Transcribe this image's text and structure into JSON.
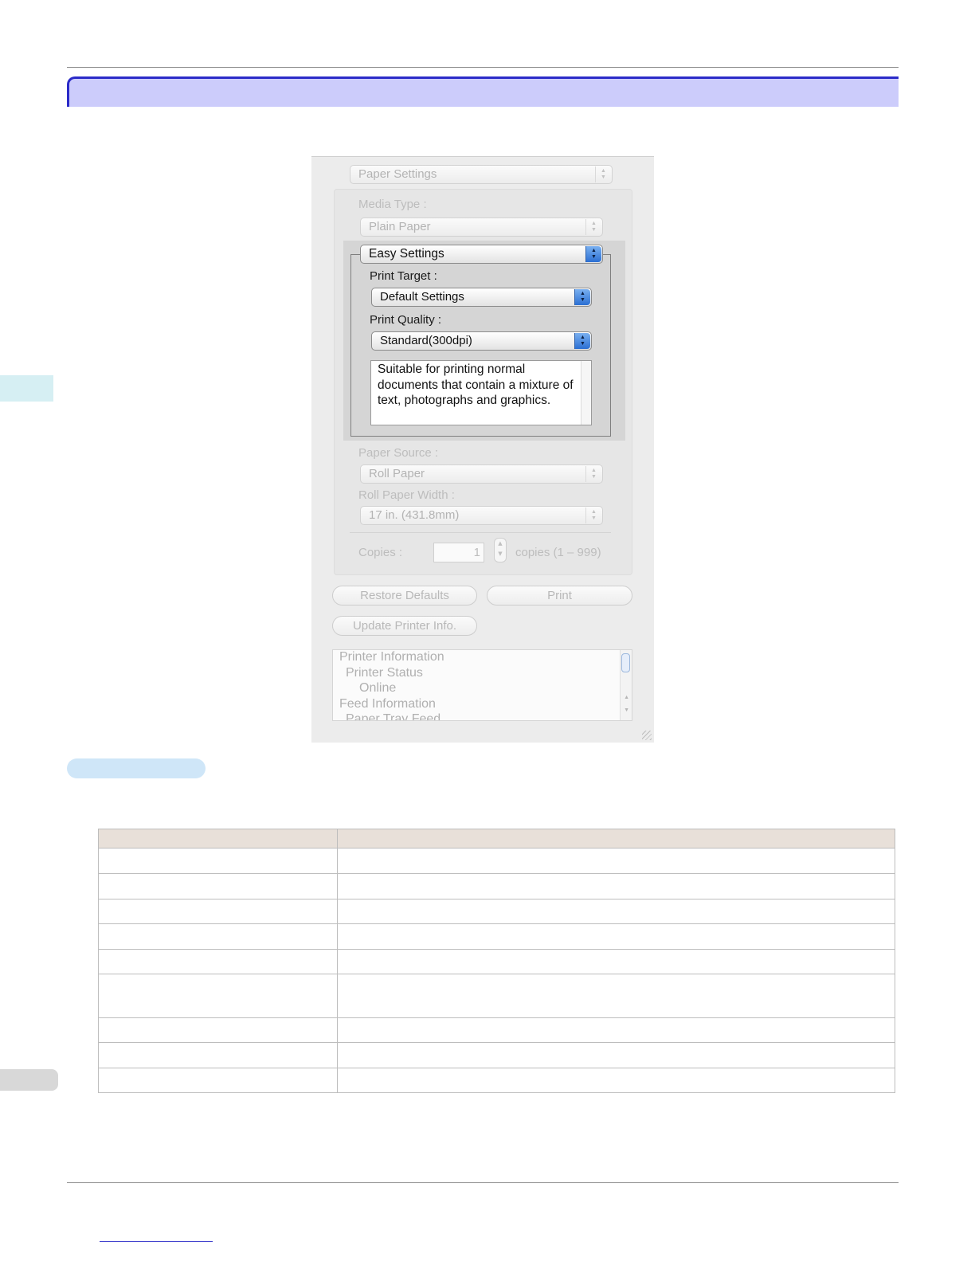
{
  "dialog": {
    "paper_settings_popup": "Paper Settings",
    "media_type_label": "Media Type :",
    "media_type_value": "Plain Paper",
    "mode_popup": "Easy Settings",
    "print_target_label": "Print Target :",
    "print_target_value": "Default Settings",
    "print_quality_label": "Print Quality :",
    "print_quality_value": "Standard(300dpi)",
    "description": "Suitable for printing normal documents that contain a mixture of text, photographs and graphics.",
    "paper_source_label": "Paper Source :",
    "paper_source_value": "Roll Paper",
    "roll_width_label": "Roll Paper Width :",
    "roll_width_value": "17 in. (431.8mm)",
    "copies_label": "Copies :",
    "copies_value": "1",
    "copies_range": "copies (1 – 999)",
    "restore_defaults_button": "Restore Defaults",
    "print_button": "Print",
    "update_printer_info_button": "Update Printer Info.",
    "info_list": [
      "Printer Information",
      "Printer Status",
      "Online",
      "Feed Information",
      "Paper Tray Feed"
    ]
  },
  "table": {
    "headers": [
      "",
      ""
    ],
    "rows": [
      [
        "",
        ""
      ],
      [
        "",
        ""
      ],
      [
        "",
        ""
      ],
      [
        "",
        ""
      ],
      [
        "",
        ""
      ],
      [
        "",
        ""
      ],
      [
        "",
        ""
      ],
      [
        "",
        ""
      ],
      [
        "",
        ""
      ]
    ]
  },
  "colors": {
    "section_banner": "#ccccfb",
    "banner_border": "#2b2bc8",
    "table_header": "#e8e0d9"
  },
  "icons": [
    "popup-arrows-icon",
    "stepper-icon",
    "resize-grip-icon"
  ]
}
